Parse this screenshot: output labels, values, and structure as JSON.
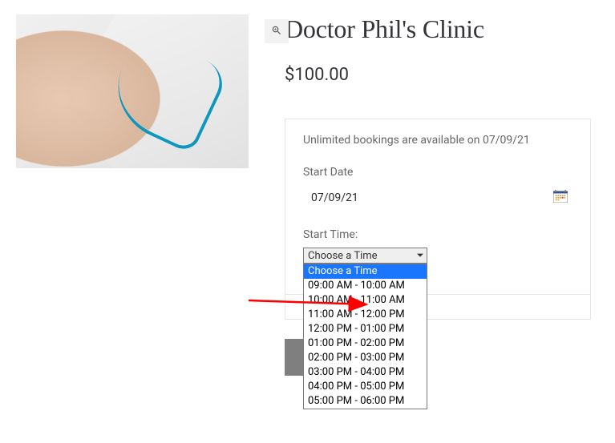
{
  "product": {
    "title": "Doctor Phil's Clinic",
    "price": "$100.00"
  },
  "booking": {
    "availability": "Unlimited bookings are available on 07/09/21",
    "start_date_label": "Start Date",
    "start_date_value": "07/09/21",
    "start_time_label": "Start Time:",
    "select_placeholder": "Choose a Time",
    "options": [
      "Choose a Time",
      "09:00 AM - 10:00 AM",
      "10:00 AM - 11:00 AM",
      "11:00 AM - 12:00 PM",
      "12:00 PM - 01:00 PM",
      "01:00 PM - 02:00 PM",
      "02:00 PM - 03:00 PM",
      "03:00 PM - 04:00 PM",
      "04:00 PM - 05:00 PM",
      "05:00 PM - 06:00 PM"
    ],
    "highlighted_index": 0
  },
  "submit": {
    "label_fragment": "!"
  }
}
